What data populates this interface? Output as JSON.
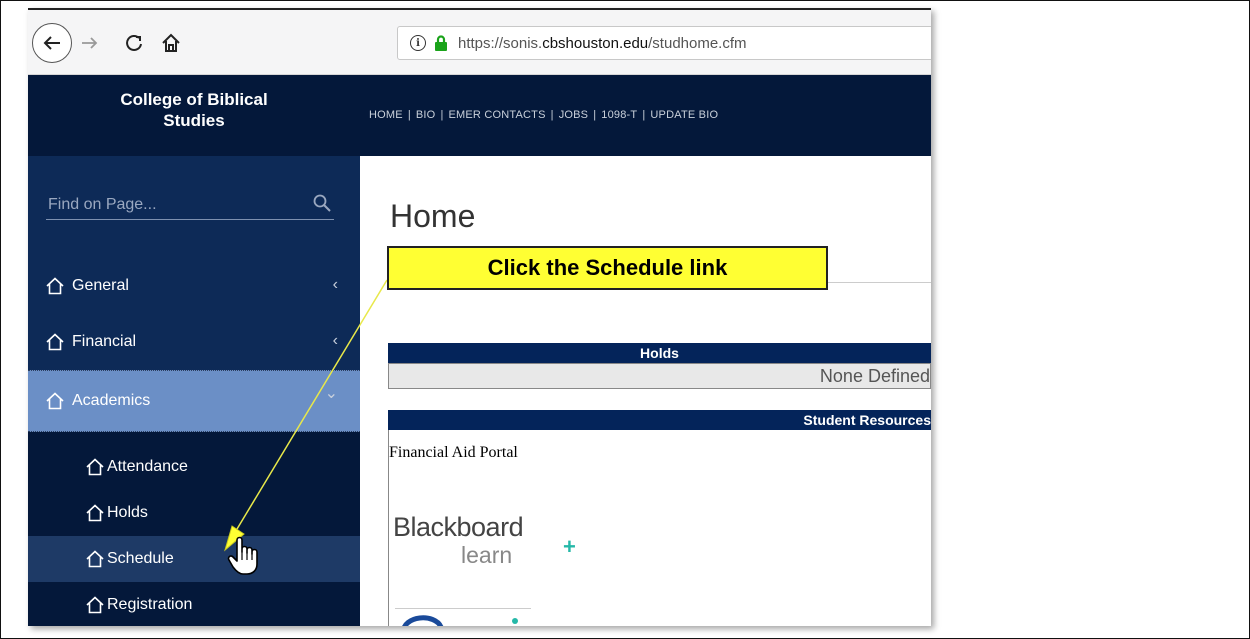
{
  "browser": {
    "url_prefix": "https://sonis.",
    "url_domain": "cbshouston.edu",
    "url_path": "/studhome.cfm"
  },
  "header": {
    "brand_line1": "College of Biblical",
    "brand_line2": "Studies",
    "nav": [
      "HOME",
      "BIO",
      "EMER CONTACTS",
      "JOBS",
      "1098-T",
      "UPDATE BIO"
    ]
  },
  "sidebar": {
    "search_placeholder": "Find on Page...",
    "items": [
      {
        "label": "General",
        "chevron": "‹"
      },
      {
        "label": "Financial",
        "chevron": "‹"
      },
      {
        "label": "Academics",
        "chevron": "⌄"
      }
    ],
    "subitems": [
      "Attendance",
      "Holds",
      "Schedule",
      "Registration"
    ]
  },
  "main": {
    "title": "Home",
    "holds_header": "Holds",
    "holds_value": "None Defined",
    "resources_header": "Student Resources",
    "fin_aid_link": "Financial Aid Portal",
    "blackboard_word": "Blackboard",
    "blackboard_learn": "learn"
  },
  "annotation": {
    "callout_text": "Click the Schedule link"
  },
  "colors": {
    "header_bg": "#04183a",
    "sidebar_bg": "#0d2a57",
    "active_item_bg": "#6b8fc6",
    "callout_bg": "#ffff33",
    "arrow": "#e8e84a"
  }
}
